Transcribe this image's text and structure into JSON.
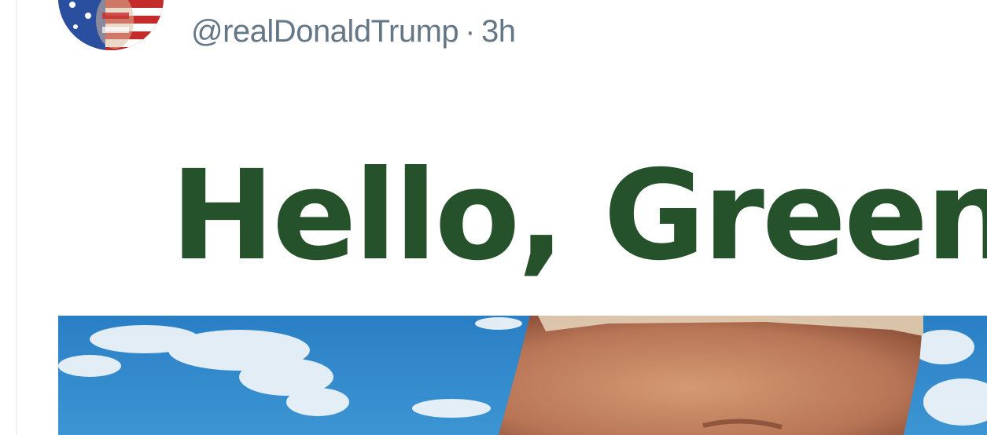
{
  "tweet": {
    "handle": "@realDonaldTrump",
    "separator": "·",
    "time": "3h",
    "media": {
      "headline": "Hello, Greenl",
      "headline_color": "#25512b",
      "photo_description": "sky-with-clouds-and-portrait"
    }
  },
  "colors": {
    "meta_text": "#657786",
    "sky": "#2f86c8"
  }
}
